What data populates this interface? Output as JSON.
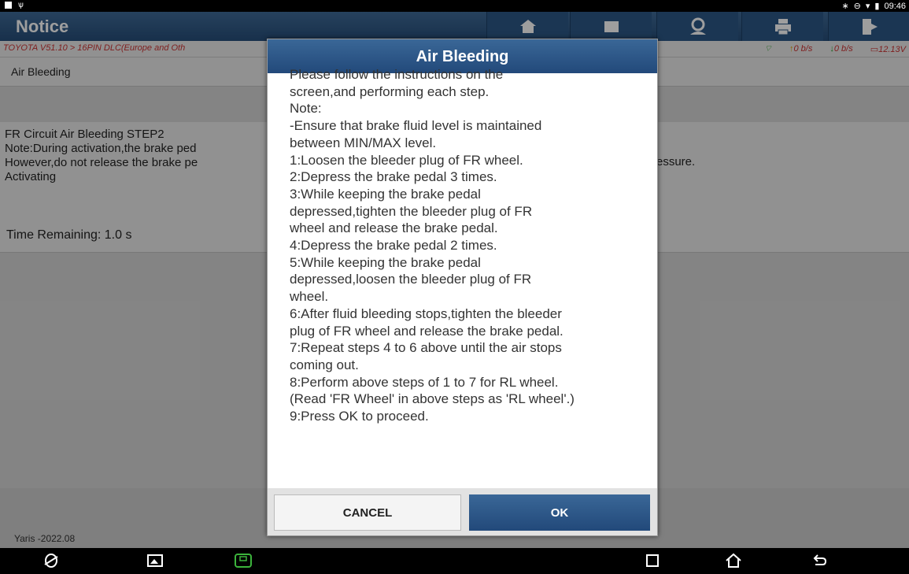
{
  "status_bar": {
    "time": "09:46",
    "icons": [
      "image-icon",
      "usb-icon",
      "bluetooth-icon",
      "dnd-icon",
      "wifi-icon",
      "battery-icon"
    ]
  },
  "header": {
    "title": "Notice",
    "buttons": [
      "home-icon",
      "window-icon",
      "support-icon",
      "print-icon",
      "exit-icon"
    ]
  },
  "breadcrumb": {
    "path": "TOYOTA V51.10 > 16PIN DLC(Europe and Oth",
    "upload": "0 b/s",
    "download": "0 b/s",
    "voltage": "12.13V"
  },
  "main": {
    "section_title": "Air Bleeding",
    "step_lines": [
      "FR Circuit Air Bleeding STEP2",
      "Note:During activation,the brake ped",
      "However,do not release the brake pe",
      "Activating"
    ],
    "step_right_fragment": "essure.",
    "time_remaining": "Time Remaining: 1.0 s"
  },
  "footer": {
    "model": "Yaris -2022.08"
  },
  "dialog": {
    "title": "Air Bleeding",
    "lines": [
      "Please follow the instructions on the",
      "screen,and performing each step.",
      "Note:",
      "-Ensure that brake fluid level is maintained",
      "between MIN/MAX level.",
      "1:Loosen the bleeder plug of FR wheel.",
      "2:Depress the brake pedal 3 times.",
      "3:While keeping the brake pedal",
      "depressed,tighten the bleeder plug of FR",
      "wheel and release the brake pedal.",
      "4:Depress the brake pedal 2 times.",
      "5:While keeping the brake pedal",
      "depressed,loosen the bleeder plug of FR",
      "wheel.",
      "6:After fluid bleeding stops,tighten the bleeder",
      "plug of FR wheel and release the brake pedal.",
      "7:Repeat steps 4 to 6 above until the air stops",
      "coming out.",
      "8:Perform above steps of 1 to 7 for RL wheel.",
      "(Read 'FR Wheel' in above steps as 'RL wheel'.)",
      "9:Press OK to proceed."
    ],
    "cancel_label": "CANCEL",
    "ok_label": "OK"
  },
  "nav_bar": {
    "icons": [
      "browser-icon",
      "gallery-icon",
      "vci-icon",
      "recents-icon",
      "home-icon",
      "back-icon"
    ]
  }
}
